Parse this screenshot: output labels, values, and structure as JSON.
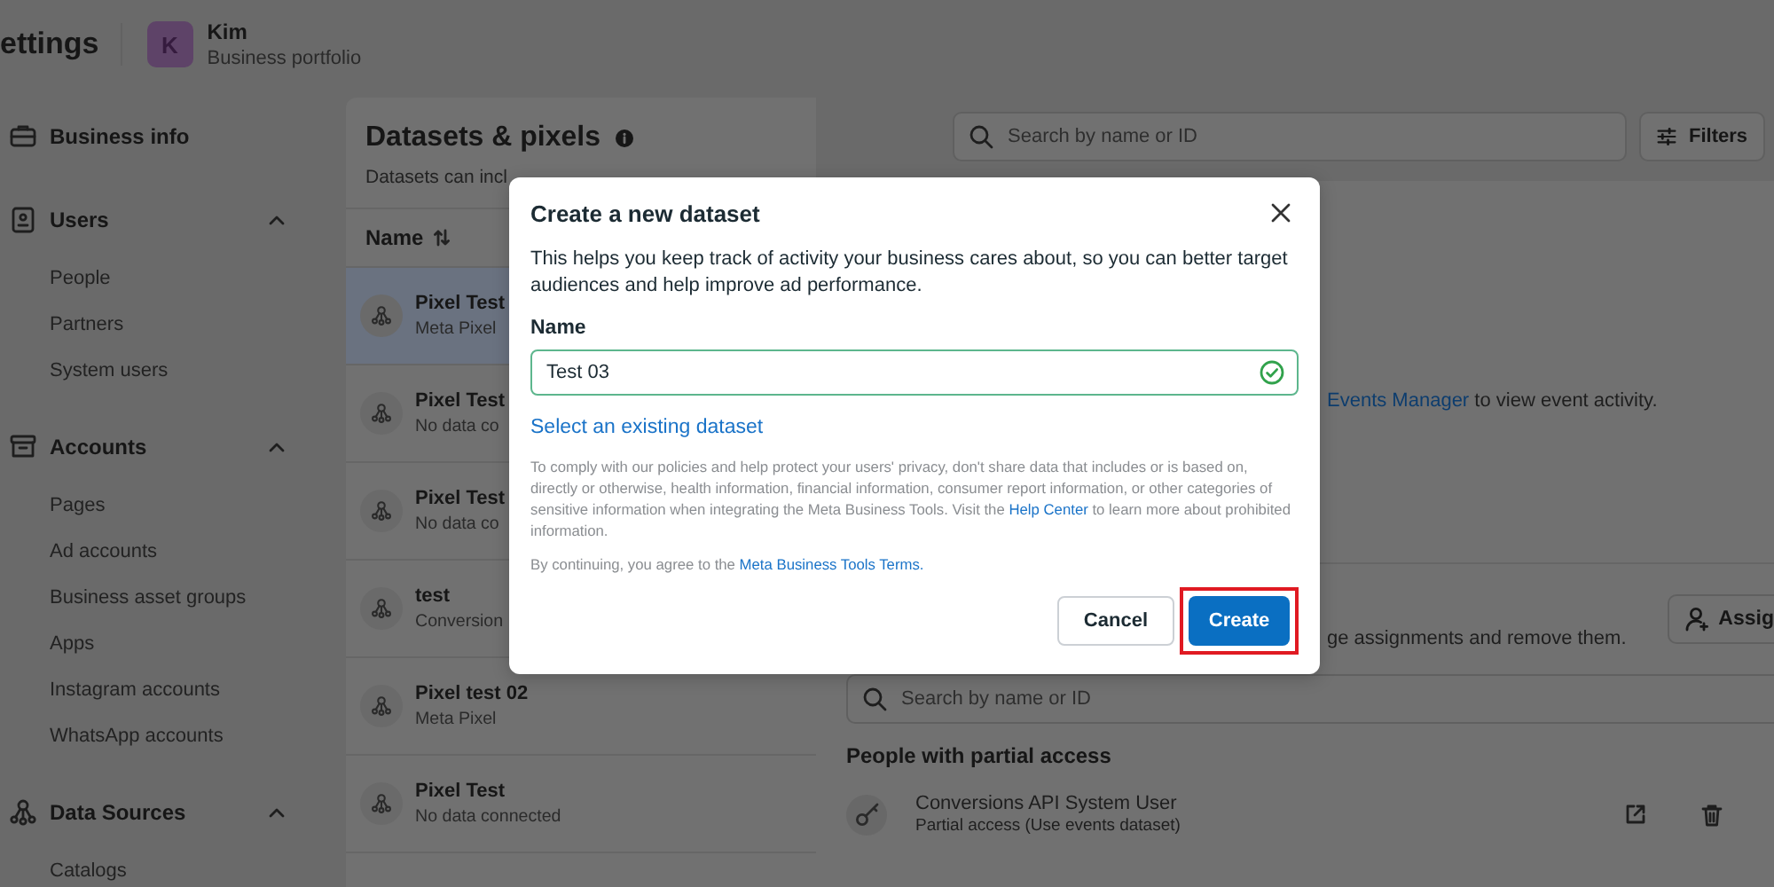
{
  "header": {
    "title": "ettings",
    "avatar_letter": "K",
    "account_name": "Kim",
    "account_type": "Business portfolio"
  },
  "sidebar": {
    "sections": [
      {
        "kind": "single",
        "label": "Business info"
      },
      {
        "kind": "group",
        "label": "Users",
        "expanded": true,
        "items": [
          "People",
          "Partners",
          "System users"
        ]
      },
      {
        "kind": "group",
        "label": "Accounts",
        "expanded": true,
        "items": [
          "Pages",
          "Ad accounts",
          "Business asset groups",
          "Apps",
          "Instagram accounts",
          "WhatsApp accounts"
        ]
      },
      {
        "kind": "group",
        "label": "Data Sources",
        "expanded": true,
        "items": [
          "Catalogs"
        ]
      }
    ]
  },
  "datasets": {
    "title": "Datasets & pixels",
    "subtitle": "Datasets can incl",
    "column": "Name",
    "rows": [
      {
        "name": "Pixel Test",
        "detail": "Meta Pixel",
        "selected": true
      },
      {
        "name": "Pixel Test",
        "detail": "No data co",
        "selected": false
      },
      {
        "name": "Pixel Test",
        "detail": "No data co",
        "selected": false
      },
      {
        "name": "test",
        "detail": "Conversion",
        "selected": false
      },
      {
        "name": "Pixel test 02",
        "detail": "Meta Pixel",
        "selected": false
      },
      {
        "name": "Pixel Test",
        "detail": "No data connected",
        "selected": false
      }
    ]
  },
  "toolbar": {
    "search_placeholder": "Search by name or ID",
    "filters_button": "Filters"
  },
  "details": {
    "events_link": "Events Manager",
    "events_text": " to view event activity.",
    "assignments_text": "ge assignments and remove them.",
    "assign_button": "Assig",
    "search_placeholder": "Search by name or ID",
    "section_title": "People with partial access",
    "people": [
      {
        "name": "Conversions API System User",
        "access": "Partial access (Use events dataset)"
      }
    ]
  },
  "dialog": {
    "title": "Create a new dataset",
    "description": "This helps you keep track of activity your business cares about, so you can better target audiences and help improve ad performance.",
    "field_label": "Name",
    "field_value": "Test 03",
    "valid": true,
    "select_link": "Select an existing dataset",
    "policy_before": "To comply with our policies and help protect your users' privacy, don't share data that includes or is based on, directly or otherwise, health information, financial information, consumer report information, or other categories of sensitive information when integrating the Meta Business Tools. Visit the ",
    "policy_link": "Help Center",
    "policy_after": " to learn more about prohibited information.",
    "terms_before": "By continuing, you agree to the ",
    "terms_link": "Meta Business Tools Terms.",
    "cancel_button": "Cancel",
    "create_button": "Create",
    "create_highlighted": true
  }
}
